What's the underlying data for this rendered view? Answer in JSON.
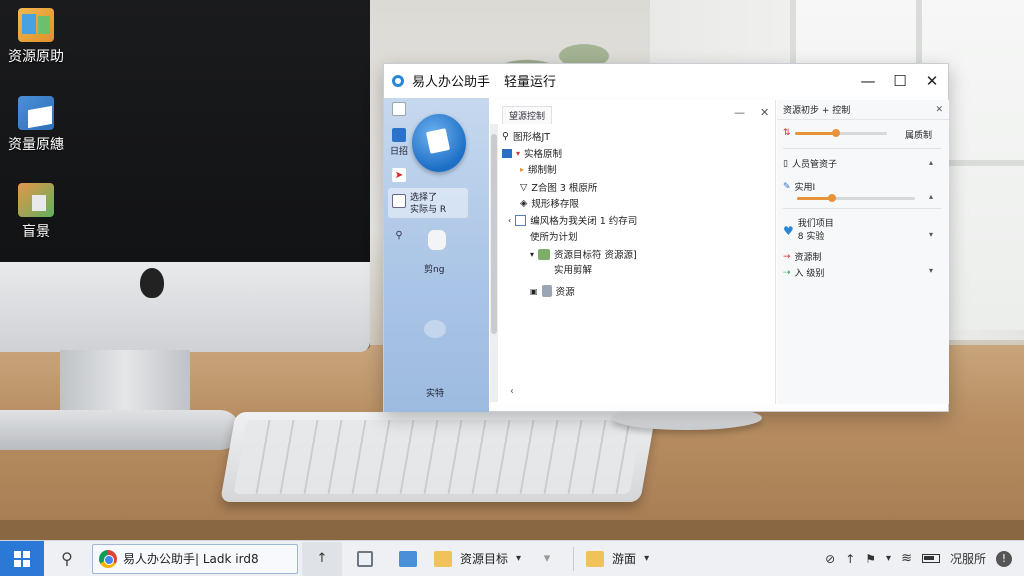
{
  "desktop": {
    "icons": [
      {
        "label": "资源原助",
        "icon": "folder-app-icon"
      },
      {
        "label": "资量原繐",
        "icon": "document-app-icon"
      },
      {
        "label": "盲景",
        "icon": "mixed-app-icon"
      }
    ]
  },
  "window": {
    "title": "易人办公助手",
    "subtitle": "轻量运行",
    "controls": {
      "minimize": "—",
      "maximize": "☐",
      "close": "✕"
    }
  },
  "sidebar": {
    "items": [
      {
        "label": "日招"
      },
      {
        "label": "选择了\n实际与 R"
      },
      {
        "label": "剪ng"
      },
      {
        "label": "实特"
      }
    ]
  },
  "tree_panel": {
    "tab_label": "望源控制",
    "rows": [
      {
        "text": "图形格JT",
        "expander": ""
      },
      {
        "text": "实格原制",
        "expander": "▾"
      },
      {
        "text": "绑制制",
        "expander": "▸"
      },
      {
        "text": "Z合图 3 根原所",
        "expander": ""
      },
      {
        "text": "规形移存限",
        "expander": ""
      },
      {
        "text": "编风格为我关闭 1 约存司",
        "expander": "‹"
      },
      {
        "text": "使所为计划",
        "expander": ""
      },
      {
        "text": "资源目标符 资源源]",
        "expander": "▾"
      },
      {
        "text": "实用剪解",
        "expander": ""
      },
      {
        "text": "资源",
        "expander": "▣"
      }
    ]
  },
  "props_panel": {
    "title": "资源初步 + 控制",
    "rows": [
      {
        "label": "属质制",
        "value": 0.45
      },
      {
        "label": "人员管资子"
      },
      {
        "label": "实用I",
        "value": 0.3
      },
      {
        "label": "我们项目\n8 实验"
      },
      {
        "label": "资源制"
      },
      {
        "label": "入 级别"
      }
    ]
  },
  "taskbar": {
    "active_app": "易人办公助手|  Ladk ird8",
    "folder_label": "资源目标",
    "app2_label": "游面",
    "clock": "况服所"
  }
}
